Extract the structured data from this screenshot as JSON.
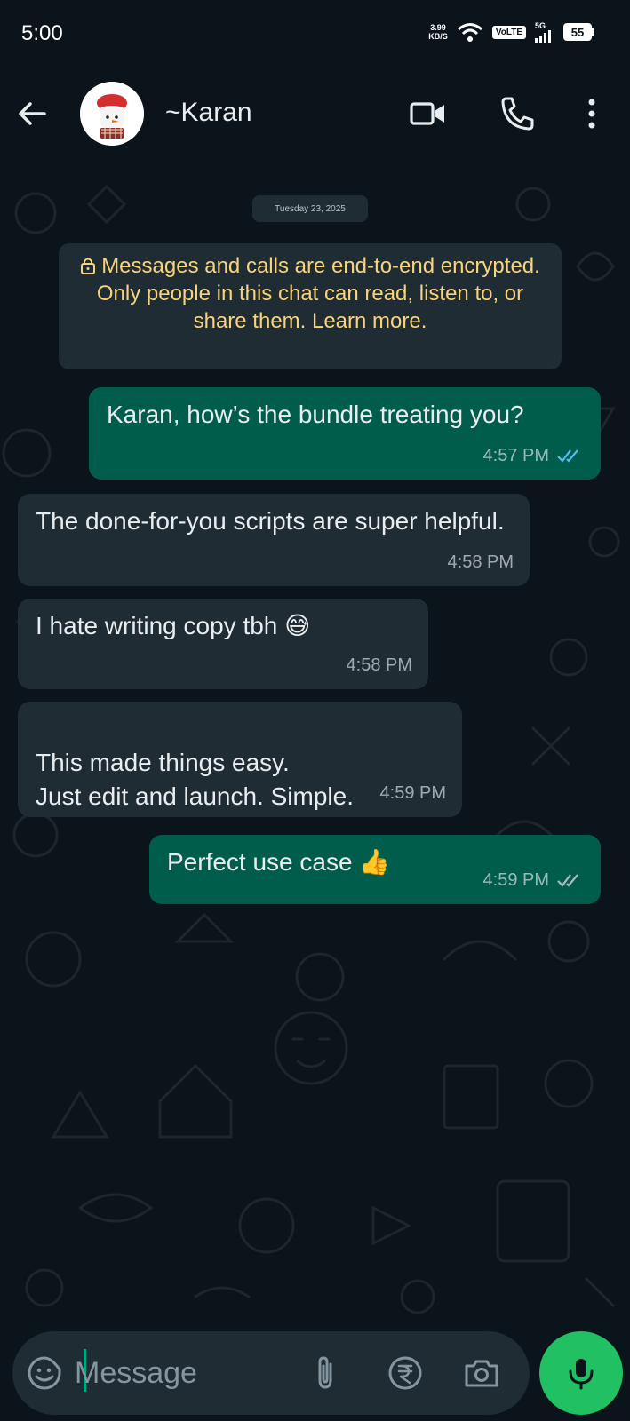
{
  "status_bar": {
    "time": "5:00",
    "net_speed_value": "3.99",
    "net_speed_unit": "KB/S",
    "volte": "VoLTE",
    "network": "5G",
    "battery": "55"
  },
  "header": {
    "contact_name": "~Karan",
    "icons": [
      "back-arrow-icon",
      "video-call-icon",
      "voice-call-icon",
      "more-options-icon"
    ]
  },
  "chat": {
    "date_chip": "Tuesday 23, 2025",
    "encryption_notice": "Messages and calls are end-to-end encrypted. Only people in this chat can read, listen to, or share them. Learn more.",
    "messages": [
      {
        "direction": "out",
        "text": "Karan, how’s the bundle treating you?",
        "time": "4:57 PM",
        "status": "read"
      },
      {
        "direction": "in",
        "text": "The done-for-you scripts are super helpful.",
        "time": "4:58 PM"
      },
      {
        "direction": "in",
        "text": "I hate writing copy tbh 😅",
        "time": "4:58 PM"
      },
      {
        "direction": "in",
        "text": "This made things easy.\nJust edit and launch. Simple.",
        "time": "4:59 PM"
      },
      {
        "direction": "out",
        "text": "Perfect use case 👍",
        "time": "4:59 PM",
        "status": "delivered"
      }
    ]
  },
  "composer": {
    "placeholder": "Message",
    "icons": [
      "emoji-sticker-icon",
      "attach-paperclip-icon",
      "rupee-payment-icon",
      "camera-icon",
      "microphone-icon"
    ]
  },
  "colors": {
    "background": "#0b141a",
    "outgoing_bubble": "#005c4b",
    "incoming_bubble": "#1f2c34",
    "notice_text": "#f7d47c",
    "read_tick": "#53bdeb",
    "mic_button": "#21c063"
  }
}
